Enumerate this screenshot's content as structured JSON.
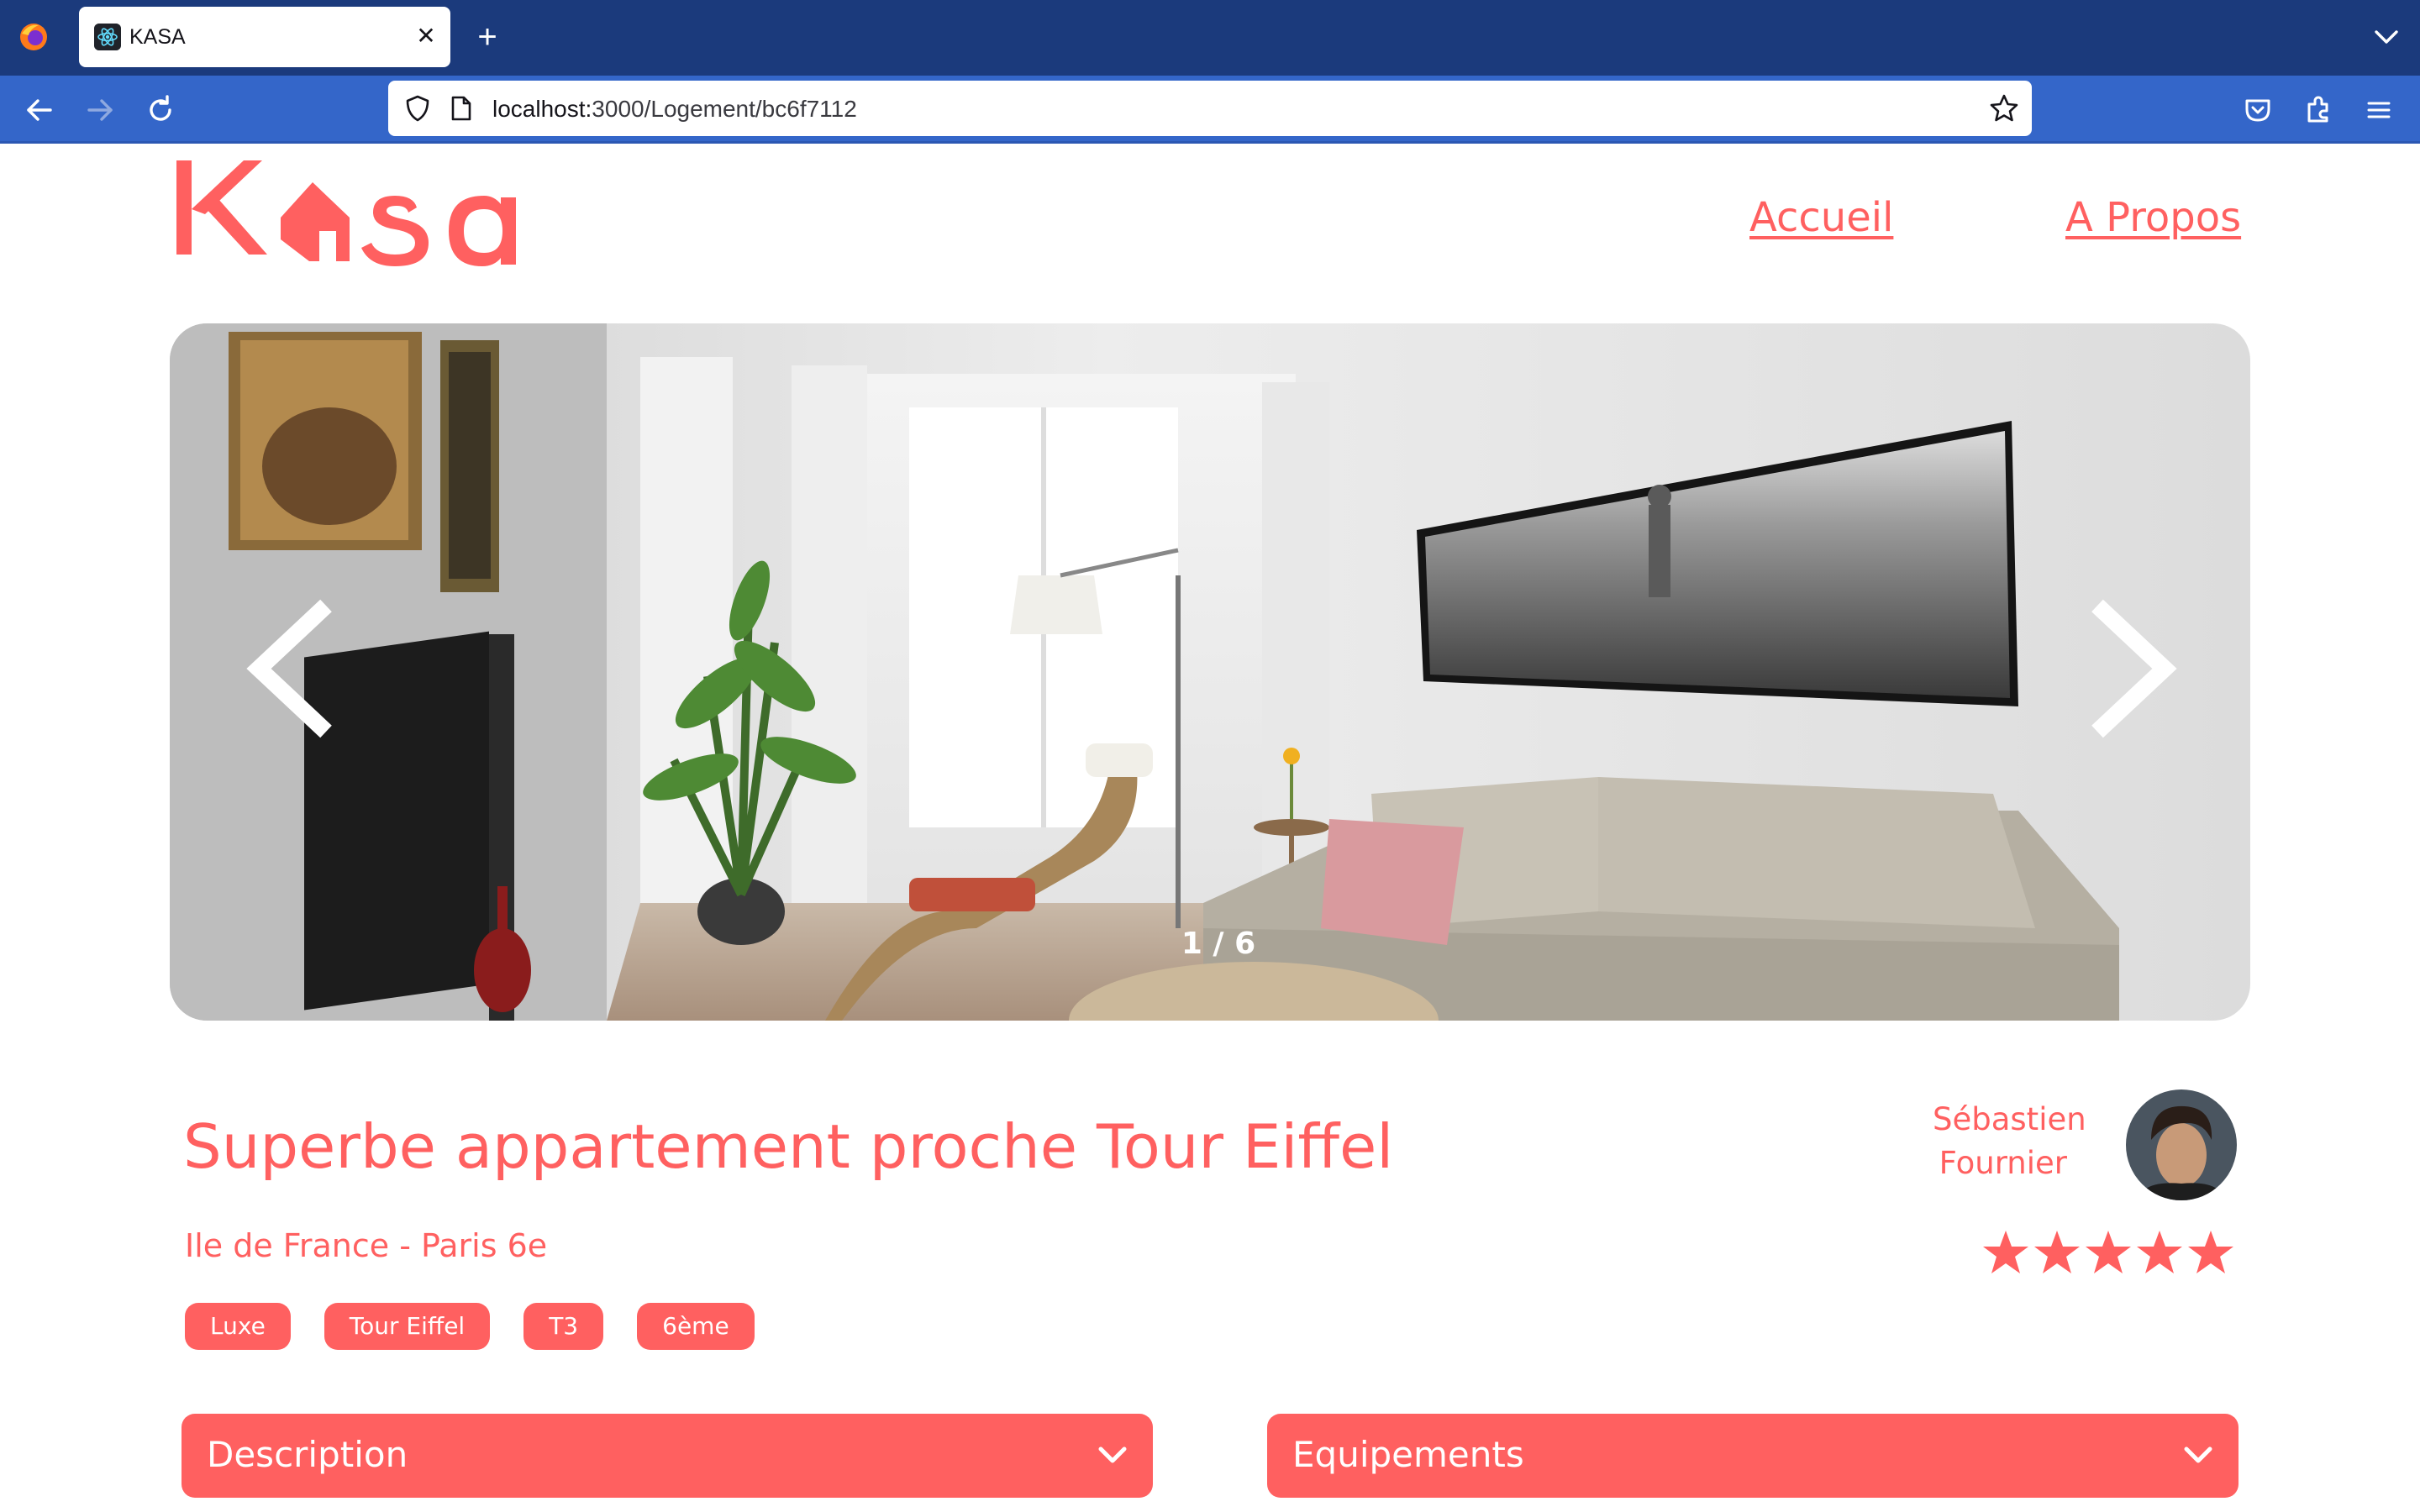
{
  "browser": {
    "tab_title": "KASA",
    "url_host": "localhost:",
    "url_rest": "3000/Logement/bc6f7112"
  },
  "header": {
    "logo_text": "Kasa",
    "nav": [
      {
        "label": "Accueil"
      },
      {
        "label": "A Propos"
      }
    ]
  },
  "slideshow": {
    "counter": "1 / 6"
  },
  "listing": {
    "title": "Superbe appartement proche Tour Eiffel",
    "location": "Ile de France - Paris 6e",
    "tags": [
      "Luxe",
      "Tour Eiffel",
      "T3",
      "6ème"
    ],
    "host": {
      "first_name": "Sébastien",
      "last_name": "Fournier"
    },
    "rating": 5,
    "rating_max": 5
  },
  "collapsibles": [
    {
      "label": "Description"
    },
    {
      "label": "Equipements"
    }
  ],
  "colors": {
    "accent": "#ff6060",
    "chrome_tabbar": "#1b3a7c",
    "chrome_toolbar": "#3466c9"
  }
}
